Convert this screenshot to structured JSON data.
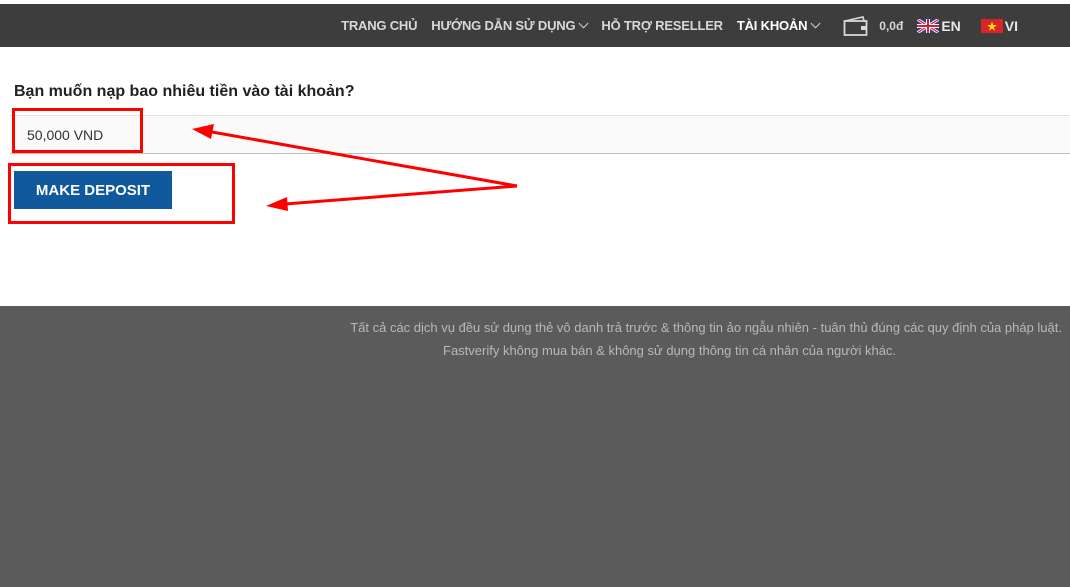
{
  "header": {
    "nav": [
      {
        "label": "TRANG CHỦ",
        "has_dropdown": false
      },
      {
        "label": "HƯỚNG DẪN SỬ DỤNG",
        "has_dropdown": true
      },
      {
        "label": "HỖ TRỢ RESELLER",
        "has_dropdown": false
      },
      {
        "label": "TÀI KHOẢN",
        "has_dropdown": true
      }
    ],
    "wallet_balance": "0,0đ",
    "languages": [
      {
        "code": "EN",
        "flag": "uk-flag"
      },
      {
        "code": "VI",
        "flag": "vn-flag"
      }
    ]
  },
  "deposit": {
    "question": "Bạn muốn nạp bao nhiêu tiền vào tài khoản?",
    "amount_value": "50,000 VND",
    "button_label": "MAKE DEPOSIT"
  },
  "footer": {
    "line1": "Tất cả các dịch vụ đều sử dụng thẻ vô danh trả trước & thông tin ảo ngẫu nhiên - tuân thủ đúng các quy định của pháp luật.",
    "line2": "Fastverify không mua bán & không sử dụng thông tin cá nhân của người khác."
  },
  "colors": {
    "nav_bg": "#3d3d3d",
    "button_bg": "#10599c",
    "annotation": "#ff0000",
    "footer_bg": "#5b5b5b"
  }
}
